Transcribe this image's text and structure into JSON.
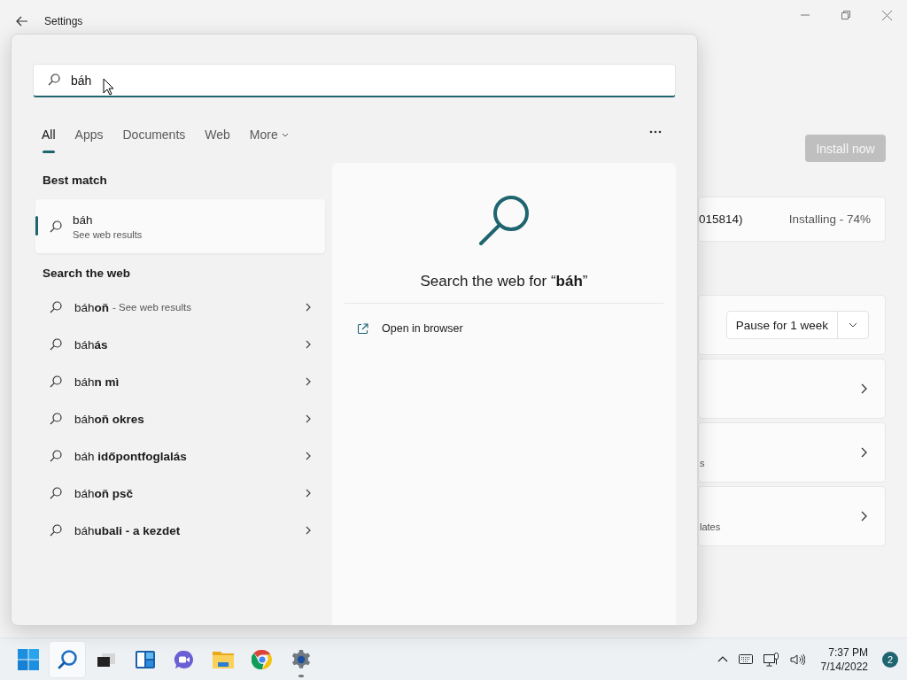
{
  "window": {
    "title": "Settings"
  },
  "settings_page": {
    "install_button": {
      "label": "Install now",
      "disabled": true
    },
    "update": {
      "name": "015814)",
      "status": "Installing - 74%"
    },
    "pause": {
      "label": "Pause for 1 week"
    },
    "rows": [
      {
        "kind": "link"
      },
      {
        "kind": "link",
        "subtitle": "s"
      },
      {
        "kind": "link",
        "subtitle": "lates"
      }
    ]
  },
  "search": {
    "value": "báh"
  },
  "tabs": [
    {
      "label": "All",
      "selected": true,
      "kind": "tab"
    },
    {
      "label": "Apps",
      "selected": false,
      "kind": "tab"
    },
    {
      "label": "Documents",
      "selected": false,
      "kind": "tab"
    },
    {
      "label": "Web",
      "selected": false,
      "kind": "tab"
    },
    {
      "label": "More",
      "selected": false,
      "kind": "menu"
    }
  ],
  "best_match": {
    "heading": "Best match",
    "title": "báh",
    "subtitle": "See web results",
    "selected": true
  },
  "web_section": {
    "heading": "Search the web",
    "suggestions": [
      {
        "text": "báh**oň**",
        "hint": "- See web results"
      },
      {
        "text": "báh**ás**"
      },
      {
        "text": "báh**n mì**"
      },
      {
        "text": "báh**oň okres**"
      },
      {
        "text": "báh **időpontfoglalás**"
      },
      {
        "text": "báh**oň psč**"
      },
      {
        "text": "báh**ubali - a kezdet**"
      }
    ]
  },
  "preview": {
    "title": "Search the web for “**báh**”",
    "actions": [
      {
        "label": "Open in browser"
      }
    ]
  },
  "taskbar": {
    "apps": [
      {
        "kind": "start",
        "selected": false,
        "running": false
      },
      {
        "kind": "search",
        "selected": true,
        "running": false
      },
      {
        "kind": "taskview",
        "selected": false,
        "running": false
      },
      {
        "kind": "widgets",
        "selected": false,
        "running": false
      },
      {
        "kind": "chat",
        "selected": false,
        "running": false
      },
      {
        "kind": "explorer",
        "selected": false,
        "running": false
      },
      {
        "kind": "browser",
        "selected": false,
        "running": false
      },
      {
        "kind": "settings",
        "selected": false,
        "running": true
      }
    ],
    "time": "7:37 PM",
    "date": "7/14/2022",
    "notifications": "2"
  }
}
